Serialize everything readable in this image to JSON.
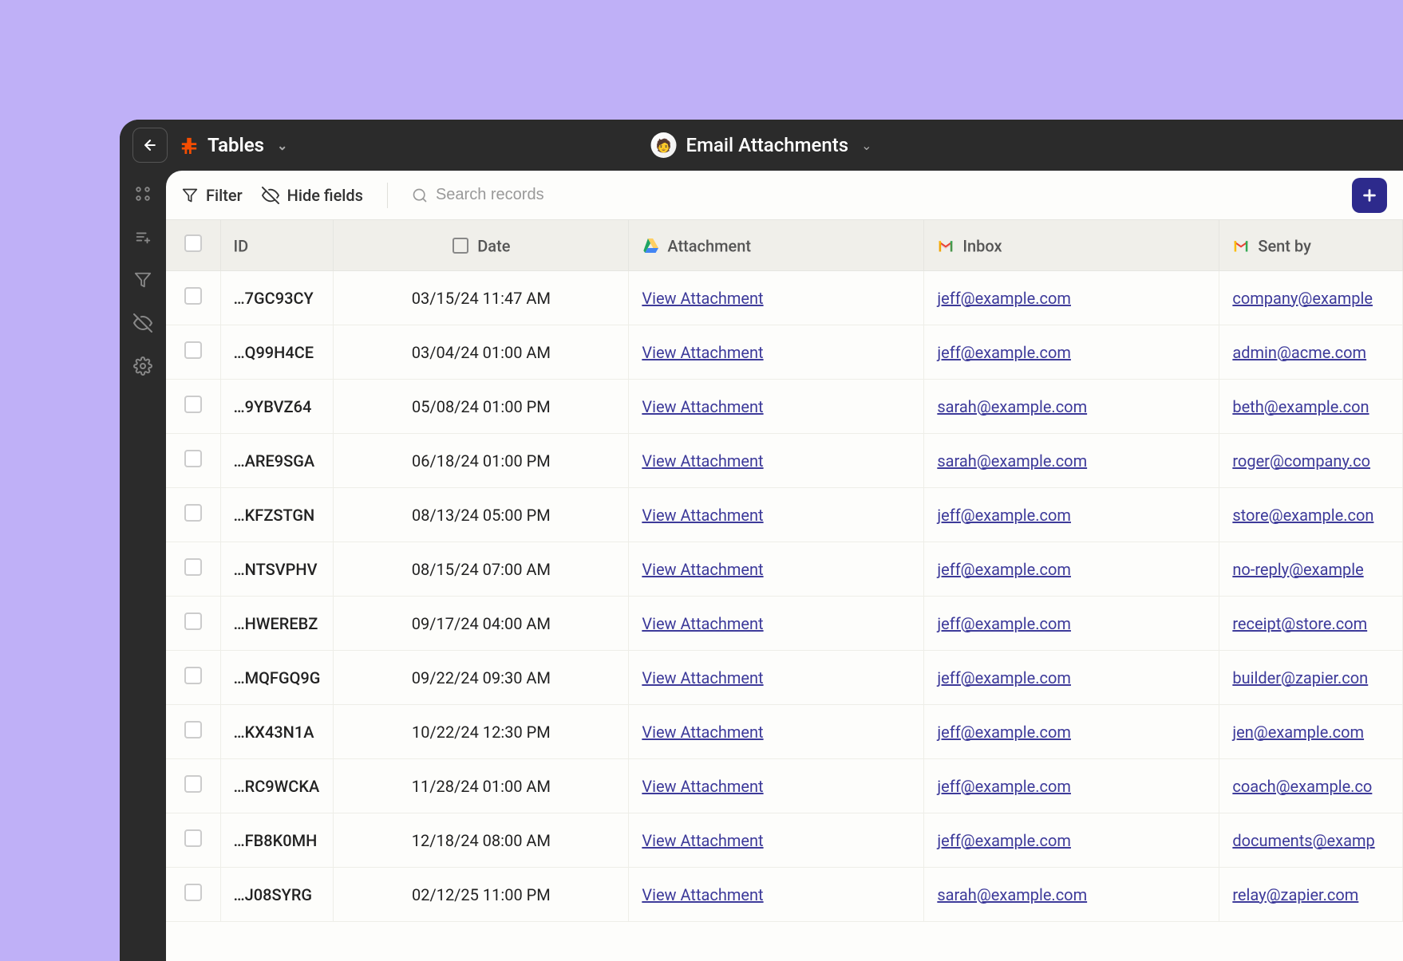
{
  "topbar": {
    "section_title": "Tables",
    "table_name": "Email Attachments"
  },
  "toolbar": {
    "filter_label": "Filter",
    "hide_fields_label": "Hide fields",
    "search_placeholder": "Search records"
  },
  "columns": {
    "id": "ID",
    "date": "Date",
    "attachment": "Attachment",
    "inbox": "Inbox",
    "sent_by": "Sent by"
  },
  "attachment_link_label": "View Attachment",
  "rows": [
    {
      "id": "…7GC93CY",
      "date": "03/15/24 11:47 AM",
      "inbox": "jeff@example.com",
      "sent_by": "company@example"
    },
    {
      "id": "…Q99H4CE",
      "date": "03/04/24 01:00 AM",
      "inbox": "jeff@example.com",
      "sent_by": "admin@acme.com"
    },
    {
      "id": "…9YBVZ64",
      "date": "05/08/24 01:00 PM",
      "inbox": "sarah@example.com",
      "sent_by": "beth@example.con"
    },
    {
      "id": "…ARE9SGA",
      "date": "06/18/24 01:00 PM",
      "inbox": "sarah@example.com",
      "sent_by": "roger@company.co"
    },
    {
      "id": "…KFZSTGN",
      "date": "08/13/24 05:00 PM",
      "inbox": "jeff@example.com",
      "sent_by": "store@example.con"
    },
    {
      "id": "…NTSVPHV",
      "date": "08/15/24 07:00 AM",
      "inbox": "jeff@example.com",
      "sent_by": "no-reply@example"
    },
    {
      "id": "…HWEREBZ",
      "date": "09/17/24 04:00 AM",
      "inbox": "jeff@example.com",
      "sent_by": "receipt@store.com"
    },
    {
      "id": "…MQFGQ9G",
      "date": "09/22/24 09:30 AM",
      "inbox": "jeff@example.com",
      "sent_by": "builder@zapier.con"
    },
    {
      "id": "…KX43N1A",
      "date": "10/22/24 12:30 PM",
      "inbox": "jeff@example.com",
      "sent_by": "jen@example.com"
    },
    {
      "id": "…RC9WCKA",
      "date": "11/28/24 01:00 AM",
      "inbox": "jeff@example.com",
      "sent_by": "coach@example.co"
    },
    {
      "id": "…FB8K0MH",
      "date": "12/18/24 08:00 AM",
      "inbox": "jeff@example.com",
      "sent_by": "documents@examp"
    },
    {
      "id": "…J08SYRG",
      "date": "02/12/25 11:00 PM",
      "inbox": "sarah@example.com",
      "sent_by": "relay@zapier.com"
    }
  ]
}
